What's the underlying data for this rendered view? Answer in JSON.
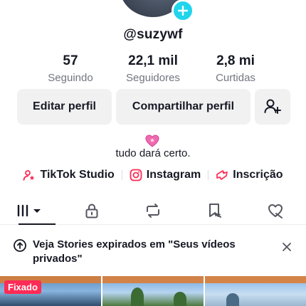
{
  "profile": {
    "username": "@suzywf",
    "bio": "tudo dará certo.",
    "bio_emoji": "heart-emoji"
  },
  "stats": [
    {
      "value": "57",
      "label": "Seguindo"
    },
    {
      "value": "22,1 mil",
      "label": "Seguidores"
    },
    {
      "value": "2,8 mi",
      "label": "Curtidas"
    }
  ],
  "buttons": {
    "edit": "Editar perfil",
    "share": "Compartilhar perfil"
  },
  "links": [
    {
      "label": "TikTok Studio",
      "icon": "tiktok-studio-icon"
    },
    {
      "label": "Instagram",
      "icon": "instagram-icon"
    },
    {
      "label": "Inscrição",
      "icon": "subscription-icon"
    }
  ],
  "tabs": [
    {
      "name": "videos",
      "icon": "grid-bars-icon",
      "active": true
    },
    {
      "name": "private",
      "icon": "lock-icon",
      "active": false
    },
    {
      "name": "reposts",
      "icon": "repost-icon",
      "active": false
    },
    {
      "name": "favorites",
      "icon": "bookmark-hidden-icon",
      "active": false
    },
    {
      "name": "liked",
      "icon": "heart-hidden-icon",
      "active": false
    }
  ],
  "notice": {
    "text": "Veja Stories expirados em \"Seus vídeos privados\""
  },
  "grid": {
    "pinned_label": "Fixado"
  },
  "colors": {
    "accent": "#fe2c55",
    "avatar_add": "#20d5ec",
    "button_bg": "#f1f1f2",
    "muted_text": "#72757f"
  }
}
